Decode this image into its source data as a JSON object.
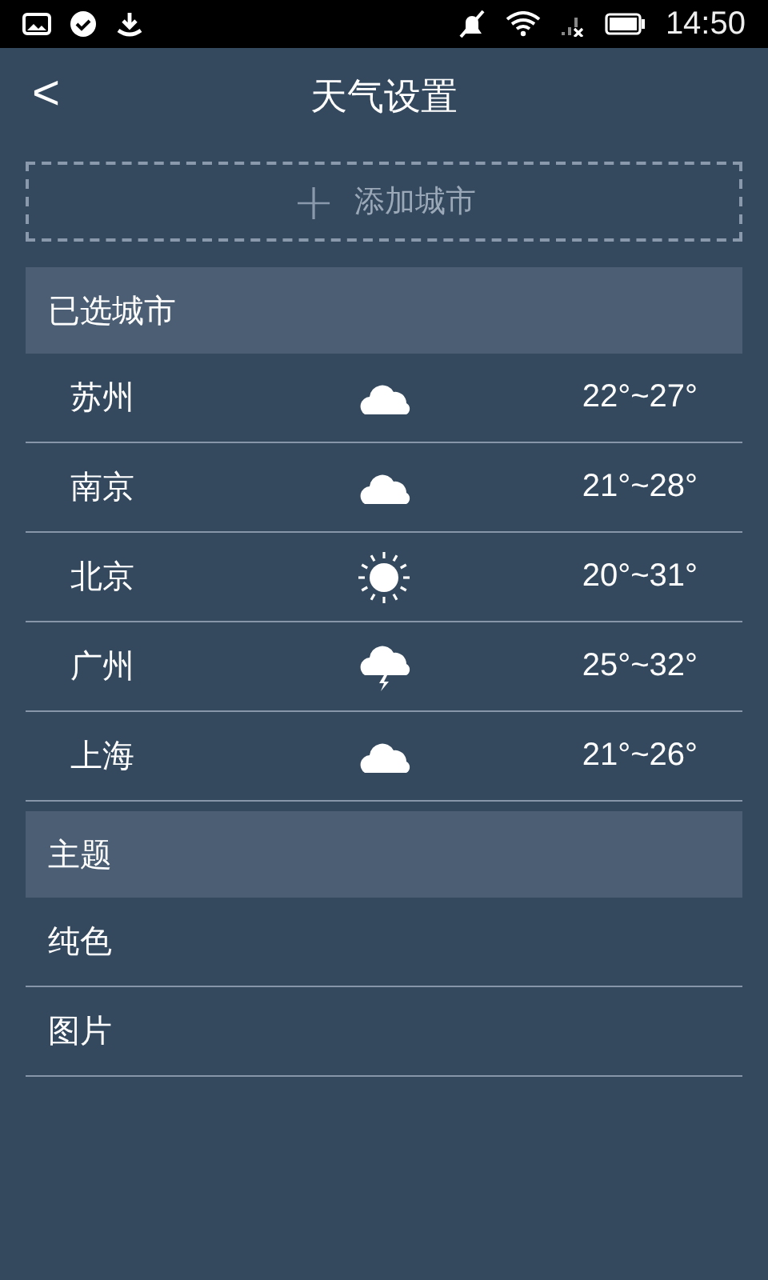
{
  "status_bar": {
    "time": "14:50"
  },
  "header": {
    "back": "<",
    "title": "天气设置"
  },
  "add_city": {
    "plus": "+",
    "label": "添加城市"
  },
  "cities_section": {
    "title": "已选城市"
  },
  "cities": [
    {
      "name": "苏州",
      "kind": "cloudy",
      "range": "22°~27°"
    },
    {
      "name": "南京",
      "kind": "cloudy",
      "range": "21°~28°"
    },
    {
      "name": "北京",
      "kind": "sunny",
      "range": "20°~31°"
    },
    {
      "name": "广州",
      "kind": "thunder",
      "range": "25°~32°"
    },
    {
      "name": "上海",
      "kind": "cloudy",
      "range": "21°~26°"
    }
  ],
  "theme_section": {
    "title": "主题"
  },
  "themes": [
    {
      "label": "纯色"
    },
    {
      "label": "图片"
    }
  ]
}
